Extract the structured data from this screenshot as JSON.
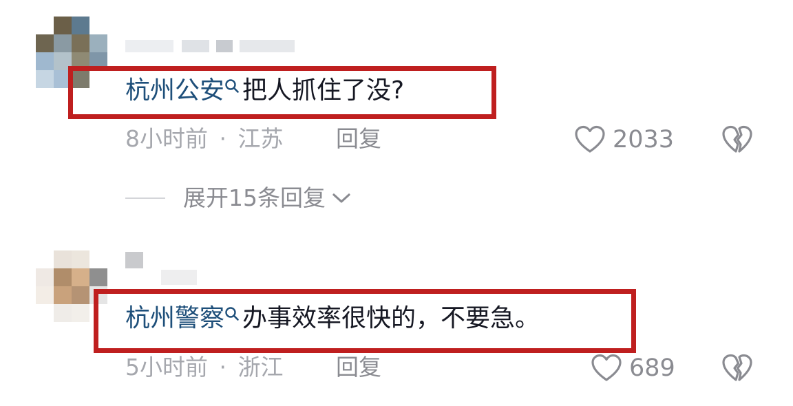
{
  "comments": [
    {
      "mention": "杭州公安",
      "text": "把人抓住了没?",
      "time": "8小时前",
      "location": "江苏",
      "reply_label": "回复",
      "likes": "2033",
      "expand_label": "展开15条回复"
    },
    {
      "mention": "杭州警察",
      "text": "办事效率很快的，不要急。",
      "time": "5小时前",
      "location": "浙江",
      "reply_label": "回复",
      "likes": "689"
    }
  ],
  "meta_separator": "·",
  "icons": {
    "mention": "search-icon",
    "like": "heart-icon",
    "dislike": "broken-heart-icon",
    "expand": "chevron-down-icon"
  },
  "colors": {
    "highlight_border": "#bf1f1f",
    "mention_text": "#1e4f7a",
    "body_text": "#161823",
    "meta_text": "#a5a7ad"
  }
}
